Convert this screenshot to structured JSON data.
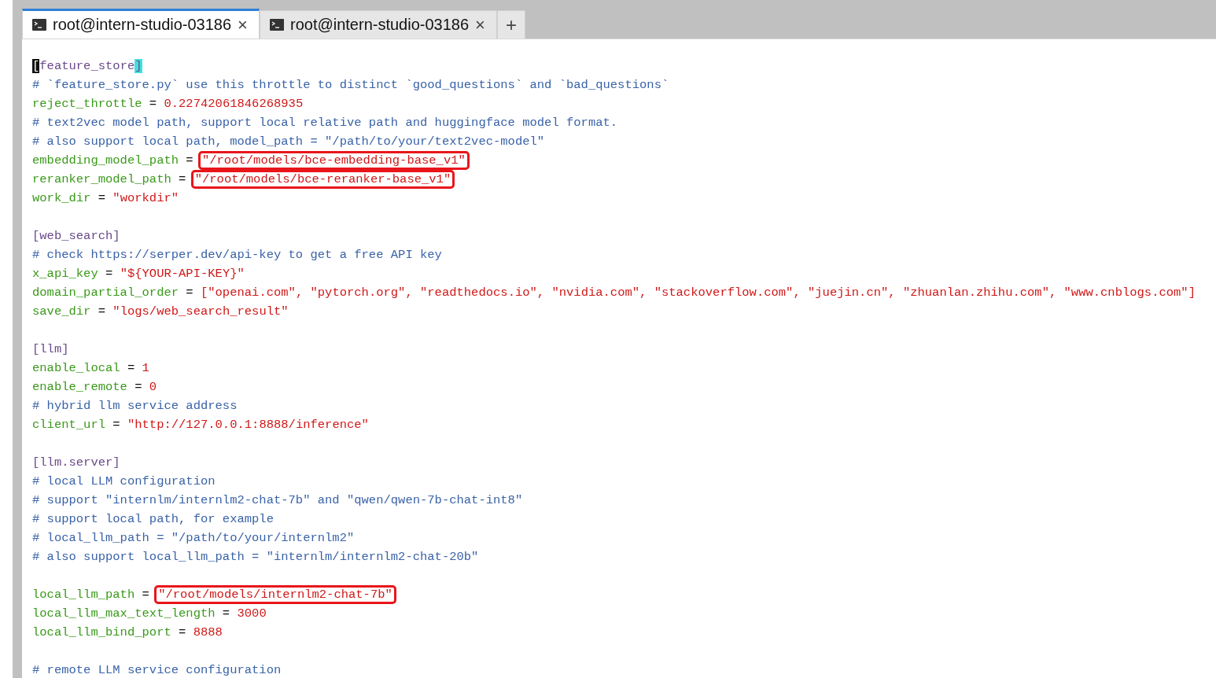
{
  "tabs": [
    {
      "label": "root@intern-studio-03186",
      "close": "×",
      "selected": true
    },
    {
      "label": "root@intern-studio-03186",
      "close": "×",
      "selected": false
    }
  ],
  "new_tab": "+",
  "lines": [
    {
      "kind": "section",
      "text": "[feature_store]",
      "cursor": true
    },
    {
      "kind": "comment",
      "text": "# `feature_store.py` use this throttle to distinct `good_questions` and `bad_questions`"
    },
    {
      "kind": "assign",
      "key": "reject_throttle",
      "op": "=",
      "value": "0.22742061846268935",
      "marked": false
    },
    {
      "kind": "comment",
      "text": "# text2vec model path, support local relative path and huggingface model format."
    },
    {
      "kind": "comment",
      "text": "# also support local path, model_path = \"/path/to/your/text2vec-model\""
    },
    {
      "kind": "assign",
      "key": "embedding_model_path",
      "op": "=",
      "value": "\"/root/models/bce-embedding-base_v1\"",
      "marked": true
    },
    {
      "kind": "assign",
      "key": "reranker_model_path",
      "op": "=",
      "value": "\"/root/models/bce-reranker-base_v1\"",
      "marked": true
    },
    {
      "kind": "assign",
      "key": "work_dir",
      "op": "=",
      "value": "\"workdir\"",
      "marked": false
    },
    {
      "kind": "blank"
    },
    {
      "kind": "section",
      "text": "[web_search]",
      "cursor": false
    },
    {
      "kind": "comment",
      "text": "# check https://serper.dev/api-key to get a free API key"
    },
    {
      "kind": "assign",
      "key": "x_api_key",
      "op": "=",
      "value": "\"${YOUR-API-KEY}\"",
      "marked": false
    },
    {
      "kind": "assign",
      "key": "domain_partial_order",
      "op": "=",
      "value": "[\"openai.com\", \"pytorch.org\", \"readthedocs.io\", \"nvidia.com\", \"stackoverflow.com\", \"juejin.cn\", \"zhuanlan.zhihu.com\", \"www.cnblogs.com\"]",
      "marked": false
    },
    {
      "kind": "assign",
      "key": "save_dir",
      "op": "=",
      "value": "\"logs/web_search_result\"",
      "marked": false
    },
    {
      "kind": "blank"
    },
    {
      "kind": "section",
      "text": "[llm]",
      "cursor": false
    },
    {
      "kind": "assign",
      "key": "enable_local",
      "op": "=",
      "value": "1",
      "marked": false
    },
    {
      "kind": "assign",
      "key": "enable_remote",
      "op": "=",
      "value": "0",
      "marked": false
    },
    {
      "kind": "comment",
      "text": "# hybrid llm service address"
    },
    {
      "kind": "assign",
      "key": "client_url",
      "op": "=",
      "value": "\"http://127.0.0.1:8888/inference\"",
      "marked": false
    },
    {
      "kind": "blank"
    },
    {
      "kind": "section",
      "text": "[llm.server]",
      "cursor": false
    },
    {
      "kind": "comment",
      "text": "# local LLM configuration"
    },
    {
      "kind": "comment",
      "text": "# support \"internlm/internlm2-chat-7b\" and \"qwen/qwen-7b-chat-int8\""
    },
    {
      "kind": "comment",
      "text": "# support local path, for example"
    },
    {
      "kind": "comment",
      "text": "# local_llm_path = \"/path/to/your/internlm2\""
    },
    {
      "kind": "comment",
      "text": "# also support local_llm_path = \"internlm/internlm2-chat-20b\""
    },
    {
      "kind": "blank"
    },
    {
      "kind": "assign",
      "key": "local_llm_path",
      "op": "=",
      "value": "\"/root/models/internlm2-chat-7b\"",
      "marked": true
    },
    {
      "kind": "assign",
      "key": "local_llm_max_text_length",
      "op": "=",
      "value": "3000",
      "marked": false
    },
    {
      "kind": "assign",
      "key": "local_llm_bind_port",
      "op": "=",
      "value": "8888",
      "marked": false
    },
    {
      "kind": "blank"
    },
    {
      "kind": "comment",
      "text": "# remote LLM service configuration"
    }
  ]
}
